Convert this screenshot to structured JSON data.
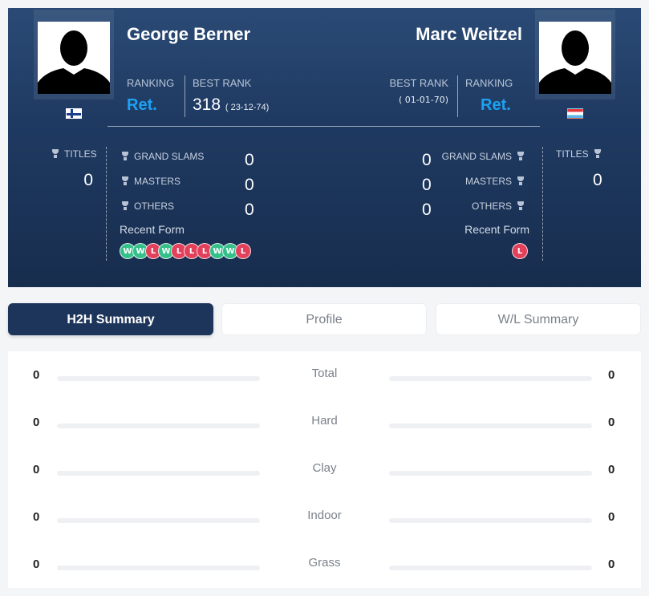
{
  "player1": {
    "name": "George Berner",
    "ranking_label": "RANKING",
    "ranking_value": "Ret.",
    "best_rank_label": "BEST RANK",
    "best_rank_value": "318",
    "best_rank_date": "( 23-12-74)",
    "flag": "finland-flag",
    "titles_label": "TITLES",
    "titles_value": "0",
    "grand_slams_label": "GRAND SLAMS",
    "grand_slams_value": "0",
    "masters_label": "MASTERS",
    "masters_value": "0",
    "others_label": "OTHERS",
    "others_value": "0",
    "recent_form_label": "Recent Form",
    "recent_form": [
      "W",
      "W",
      "L",
      "W",
      "L",
      "L",
      "L",
      "W",
      "W",
      "L"
    ]
  },
  "player2": {
    "name": "Marc Weitzel",
    "ranking_label": "RANKING",
    "ranking_value": "Ret.",
    "best_rank_label": "BEST RANK",
    "best_rank_date": "( 01-01-70)",
    "flag": "luxembourg-flag",
    "titles_label": "TITLES",
    "titles_value": "0",
    "grand_slams_label": "GRAND SLAMS",
    "grand_slams_value": "0",
    "masters_label": "MASTERS",
    "masters_value": "0",
    "others_label": "OTHERS",
    "others_value": "0",
    "recent_form_label": "Recent Form",
    "recent_form": [
      "L"
    ]
  },
  "tabs": [
    {
      "label": "H2H Summary",
      "active": true
    },
    {
      "label": "Profile",
      "active": false
    },
    {
      "label": "W/L Summary",
      "active": false
    }
  ],
  "h2h_rows": [
    {
      "label": "Total",
      "left": "0",
      "right": "0",
      "left_fraction": 0,
      "right_fraction": 0
    },
    {
      "label": "Hard",
      "left": "0",
      "right": "0",
      "left_fraction": 0,
      "right_fraction": 0
    },
    {
      "label": "Clay",
      "left": "0",
      "right": "0",
      "left_fraction": 0,
      "right_fraction": 0
    },
    {
      "label": "Indoor",
      "left": "0",
      "right": "0",
      "left_fraction": 0,
      "right_fraction": 0
    },
    {
      "label": "Grass",
      "left": "0",
      "right": "0",
      "left_fraction": 0,
      "right_fraction": 0
    }
  ],
  "colors": {
    "accent": "#1da1f2",
    "win": "#35c08a",
    "loss": "#e2405b",
    "header_bg": "#1e355b"
  }
}
